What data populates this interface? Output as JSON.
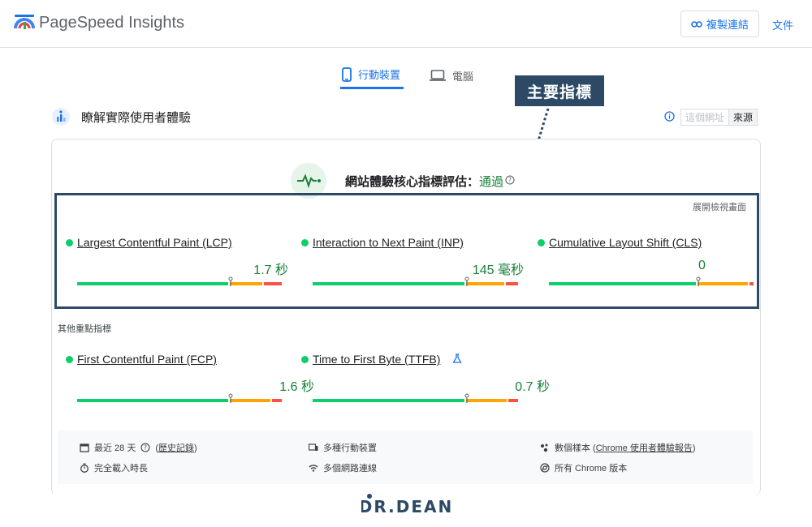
{
  "header": {
    "app_title": "PageSpeed Insights",
    "copy_link_label": "複製連結",
    "docs_label": "文件"
  },
  "tabs": [
    {
      "label": "行動裝置",
      "active": true
    },
    {
      "label": "電腦",
      "active": false
    }
  ],
  "annotation": {
    "label": "主要指標"
  },
  "section": {
    "title": "瞭解實際使用者體驗",
    "toggle": [
      "這個網址",
      "來源"
    ]
  },
  "cwv": {
    "title": "網站體驗核心指標評估：",
    "status": "通過",
    "expand_label": "展開檢視畫面"
  },
  "core_metrics": [
    {
      "name": "Largest Contentful Paint (LCP)",
      "value": "1.7 秒",
      "good_pct": 75,
      "ok_pct": 16,
      "poor_pct": 9,
      "marker_pct": 75
    },
    {
      "name": "Interaction to Next Paint (INP)",
      "value": "145 毫秒",
      "good_pct": 75,
      "ok_pct": 19,
      "poor_pct": 6,
      "marker_pct": 75
    },
    {
      "name": "Cumulative Layout Shift (CLS)",
      "value": "0",
      "good_pct": 73,
      "ok_pct": 25,
      "poor_pct": 2,
      "marker_pct": 73
    }
  ],
  "other_label": "其他重點指標",
  "other_metrics": [
    {
      "name": "First Contentful Paint (FCP)",
      "value": "1.6 秒",
      "good_pct": 75,
      "ok_pct": 20,
      "poor_pct": 5,
      "marker_pct": 75
    },
    {
      "name": "Time to First Byte (TTFB)",
      "value": "0.7 秒",
      "good_pct": 75,
      "ok_pct": 20,
      "poor_pct": 5,
      "marker_pct": 75
    }
  ],
  "info": {
    "period_prefix": "最近 28 天",
    "history_link": "歷史記錄",
    "devices": "多種行動裝置",
    "samples_prefix": "數個樣本 (",
    "samples_link": "Chrome 使用者體驗報告",
    "samples_suffix": ")",
    "load_time": "完全載入時長",
    "network": "多個網路連線",
    "chrome_versions": "所有 Chrome 版本"
  },
  "watermark": {
    "text": "DR.DEAN"
  },
  "colors": {
    "accent": "#1a73e8",
    "good": "#0cce6b",
    "average": "#ffa400",
    "poor": "#ff4e42",
    "annotation": "#2c4a66"
  }
}
